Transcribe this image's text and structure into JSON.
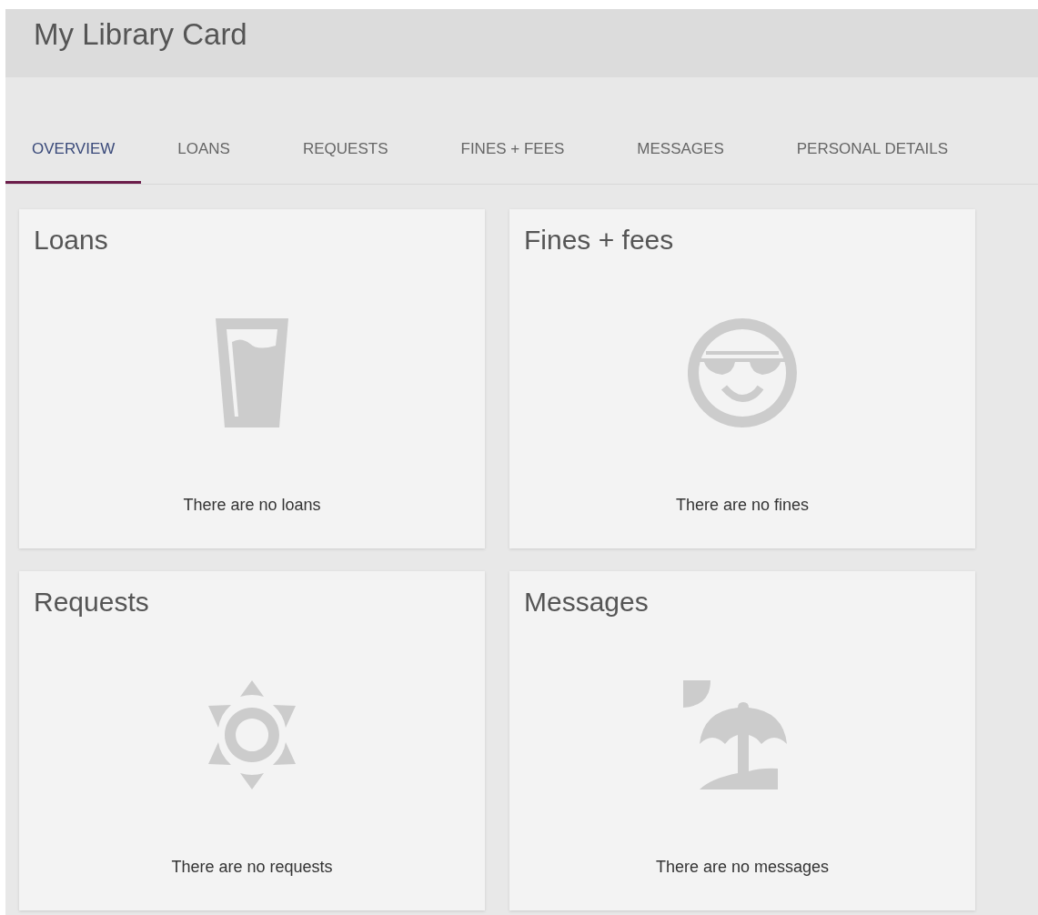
{
  "header": {
    "title": "My Library Card"
  },
  "tabs": [
    {
      "label": "OVERVIEW",
      "selected": true
    },
    {
      "label": "LOANS",
      "selected": false
    },
    {
      "label": "REQUESTS",
      "selected": false
    },
    {
      "label": "FINES + FEES",
      "selected": false
    },
    {
      "label": "MESSAGES",
      "selected": false
    },
    {
      "label": "PERSONAL DETAILS",
      "selected": false
    }
  ],
  "cards": [
    {
      "title": "Loans",
      "message": "There are no loans"
    },
    {
      "title": "Fines + fees",
      "message": "There are no fines"
    },
    {
      "title": "Requests",
      "message": "There are no requests"
    },
    {
      "title": "Messages",
      "message": "There are no messages"
    }
  ]
}
